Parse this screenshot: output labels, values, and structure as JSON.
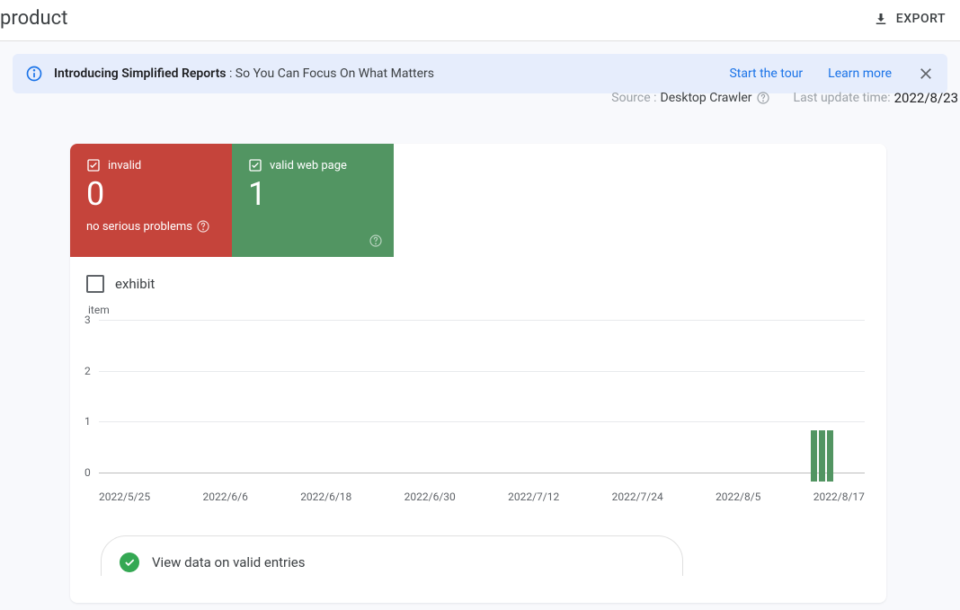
{
  "header": {
    "title": "product",
    "export_label": "EXPORT"
  },
  "banner": {
    "bold": "Introducing Simplified Reports",
    "rest": " : So You Can Focus On What Matters",
    "tour": "Start the tour",
    "learn": "Learn more"
  },
  "meta": {
    "source_label": "Source : ",
    "source_value": "Desktop Crawler",
    "update_label": "Last update time: ",
    "update_value": "2022/8/23"
  },
  "stats": {
    "invalid": {
      "label": "invalid",
      "count": "0",
      "sub": "no serious problems"
    },
    "valid": {
      "label": "valid web page",
      "count": "1"
    }
  },
  "exhibit": {
    "label": "exhibit"
  },
  "valid_entries": {
    "label": "View data on valid entries"
  },
  "chart_data": {
    "type": "bar",
    "ylabel": "item",
    "yticks": [
      0,
      1,
      2,
      3
    ],
    "ylim": [
      0,
      3
    ],
    "xticks": [
      "2022/5/25",
      "2022/6/6",
      "2022/6/18",
      "2022/6/30",
      "2022/7/12",
      "2022/7/24",
      "2022/8/5",
      "2022/8/17"
    ],
    "series": [
      {
        "name": "valid",
        "color": "#529562",
        "values": [
          0,
          0,
          0,
          0,
          0,
          0,
          0,
          0,
          0,
          0,
          0,
          0,
          0,
          0,
          0,
          0,
          0,
          0,
          0,
          0,
          0,
          0,
          0,
          0,
          0,
          0,
          0,
          0,
          0,
          0,
          0,
          0,
          0,
          0,
          0,
          0,
          0,
          0,
          0,
          0,
          0,
          0,
          0,
          0,
          0,
          0,
          0,
          0,
          0,
          0,
          0,
          0,
          0,
          0,
          0,
          0,
          0,
          0,
          0,
          0,
          0,
          0,
          0,
          0,
          0,
          0,
          0,
          0,
          0,
          0,
          0,
          0,
          0,
          0,
          0,
          0,
          0,
          0,
          0,
          0,
          0,
          0,
          0,
          0,
          0,
          0,
          0,
          0,
          1,
          1,
          1
        ]
      }
    ]
  }
}
